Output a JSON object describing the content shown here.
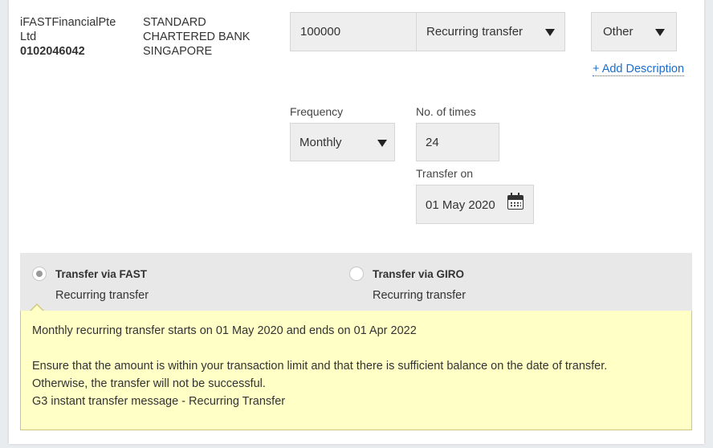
{
  "recipient": {
    "name": "iFASTFinancialPte Ltd",
    "account_number": "0102046042",
    "bank": "STANDARD CHARTERED BANK SINGAPORE"
  },
  "amount": {
    "value": "100000"
  },
  "transfer_type": {
    "selected": "Recurring transfer"
  },
  "purpose": {
    "selected": "Other"
  },
  "add_description_label": "+ Add Description",
  "frequency": {
    "label": "Frequency",
    "selected": "Monthly"
  },
  "times": {
    "label": "No. of times",
    "value": "24"
  },
  "transfer_on": {
    "label": "Transfer on",
    "value": "01 May 2020"
  },
  "methods": [
    {
      "title": "Transfer via FAST",
      "subtitle": "Recurring transfer",
      "selected": true
    },
    {
      "title": "Transfer via GIRO",
      "subtitle": "Recurring transfer",
      "selected": false
    }
  ],
  "notice": {
    "summary": "Monthly recurring transfer starts on 01 May 2020 and ends on 01 Apr 2022",
    "line1": "Ensure that the amount is within your transaction limit and that there is sufficient balance on the date of transfer.",
    "line2": "Otherwise, the transfer will not be successful.",
    "line3": "G3 instant transfer message - Recurring Transfer"
  },
  "colors": {
    "link": "#1a6ecf",
    "notice_bg": "#ffffc6",
    "notice_border": "#cfc77d",
    "field_bg": "#eeeeee",
    "method_bar_bg": "#e8e8e8"
  },
  "icons": {
    "dropdown": "caret-down",
    "date": "calendar-icon"
  }
}
